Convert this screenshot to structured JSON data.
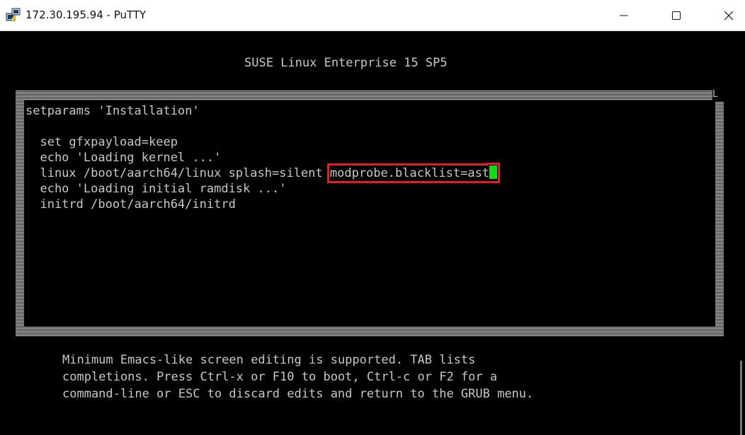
{
  "window": {
    "title": "172.30.195.94 - PuTTY",
    "minimize_symbol": "—",
    "maximize_symbol": "☐",
    "close_symbol": "✕",
    "app_icon": "putty-icon"
  },
  "terminal": {
    "header": "SUSE Linux Enterprise 15 SP5",
    "corner_char": "L",
    "editor_lines": [
      "setparams 'Installation'",
      "",
      "  set gfxpayload=keep",
      "  echo 'Loading kernel ...'",
      "  linux /boot/aarch64/linux splash=silent ",
      "  echo 'Loading initial ramdisk ...'",
      "  initrd /boot/aarch64/initrd"
    ],
    "highlighted_text": "modprobe.blacklist=ast",
    "highlight_color": "#e41d1d",
    "cursor_color": "#10e010",
    "help_lines": [
      "Minimum Emacs-like screen editing is supported. TAB lists",
      "completions. Press Ctrl-x or F10 to boot, Ctrl-c or F2 for a",
      "command-line or ESC to discard edits and return to the GRUB menu."
    ]
  }
}
